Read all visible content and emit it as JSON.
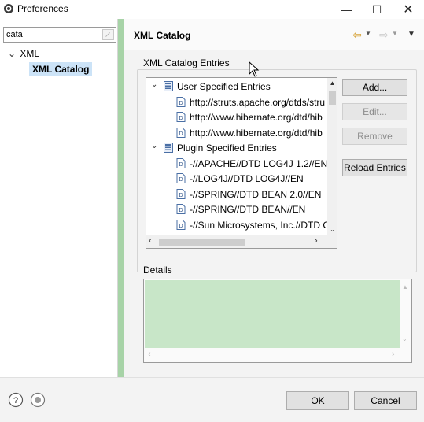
{
  "window": {
    "title": "Preferences",
    "minimize_glyph": "—",
    "maximize_glyph": "☐",
    "close_glyph": "✕"
  },
  "sidebar": {
    "filter_value": "cata",
    "tree": [
      {
        "label": "XML",
        "expanded": true
      },
      {
        "label": "XML Catalog",
        "selected": true
      }
    ]
  },
  "page": {
    "title": "XML Catalog",
    "nav": {
      "back_icon": "back-arrow-icon",
      "forward_icon": "forward-arrow-icon",
      "menu_icon": "view-menu-icon"
    }
  },
  "entries": {
    "group_title": "XML Catalog Entries",
    "rows": [
      {
        "label": "User Specified Entries",
        "type": "group",
        "icon": "catalog-icon"
      },
      {
        "label": "http://struts.apache.org/dtds/stru",
        "type": "item",
        "icon": "dtd-file-icon"
      },
      {
        "label": "http://www.hibernate.org/dtd/hib",
        "type": "item",
        "icon": "dtd-file-icon"
      },
      {
        "label": "http://www.hibernate.org/dtd/hib",
        "type": "item",
        "icon": "dtd-file-icon"
      },
      {
        "label": "Plugin Specified Entries",
        "type": "group",
        "icon": "catalog-icon"
      },
      {
        "label": "-//APACHE//DTD LOG4J 1.2//EN",
        "type": "item",
        "icon": "dtd-file-icon"
      },
      {
        "label": "-//LOG4J//DTD LOG4J//EN",
        "type": "item",
        "icon": "dtd-file-icon"
      },
      {
        "label": "-//SPRING//DTD BEAN 2.0//EN",
        "type": "item",
        "icon": "dtd-file-icon"
      },
      {
        "label": "-//SPRING//DTD BEAN//EN",
        "type": "item",
        "icon": "dtd-file-icon"
      },
      {
        "label": "-//Sun Microsystems, Inc.//DTD C",
        "type": "item",
        "icon": "dtd-file-icon"
      }
    ],
    "buttons": {
      "add": "Add...",
      "edit": "Edit...",
      "remove": "Remove",
      "reload": "Reload Entries"
    }
  },
  "details": {
    "title": "Details"
  },
  "footer": {
    "help_icon": "help-icon",
    "import_icon": "import-export-icon",
    "ok": "OK",
    "cancel": "Cancel"
  },
  "colors": {
    "selection": "#cce3f7",
    "accent_green": "#a7d3a7",
    "details_bg": "#c8e6c8"
  }
}
